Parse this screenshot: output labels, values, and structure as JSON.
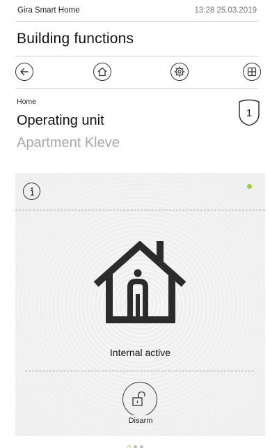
{
  "status_bar": {
    "app_name": "Gira Smart Home",
    "datetime": "13:28 25.03.2019"
  },
  "header": {
    "title": "Building functions"
  },
  "nav": [
    {
      "name": "back",
      "icon": "arrow-left-icon"
    },
    {
      "name": "home",
      "icon": "home-icon"
    },
    {
      "name": "settings",
      "icon": "gear-icon"
    },
    {
      "name": "overview",
      "icon": "grid-icon"
    }
  ],
  "breadcrumb": "Home",
  "device": {
    "title": "Operating unit",
    "subtitle": "Apartment Kleve",
    "badge": "1"
  },
  "panel": {
    "status_color": "#9bd13a",
    "state_label": "Internal active",
    "action_label": "Disarm",
    "action_icon": "unlock-icon",
    "info_icon": "info-icon",
    "main_icon": "house-person-icon"
  },
  "pager": {
    "count": 3,
    "active": 0
  }
}
